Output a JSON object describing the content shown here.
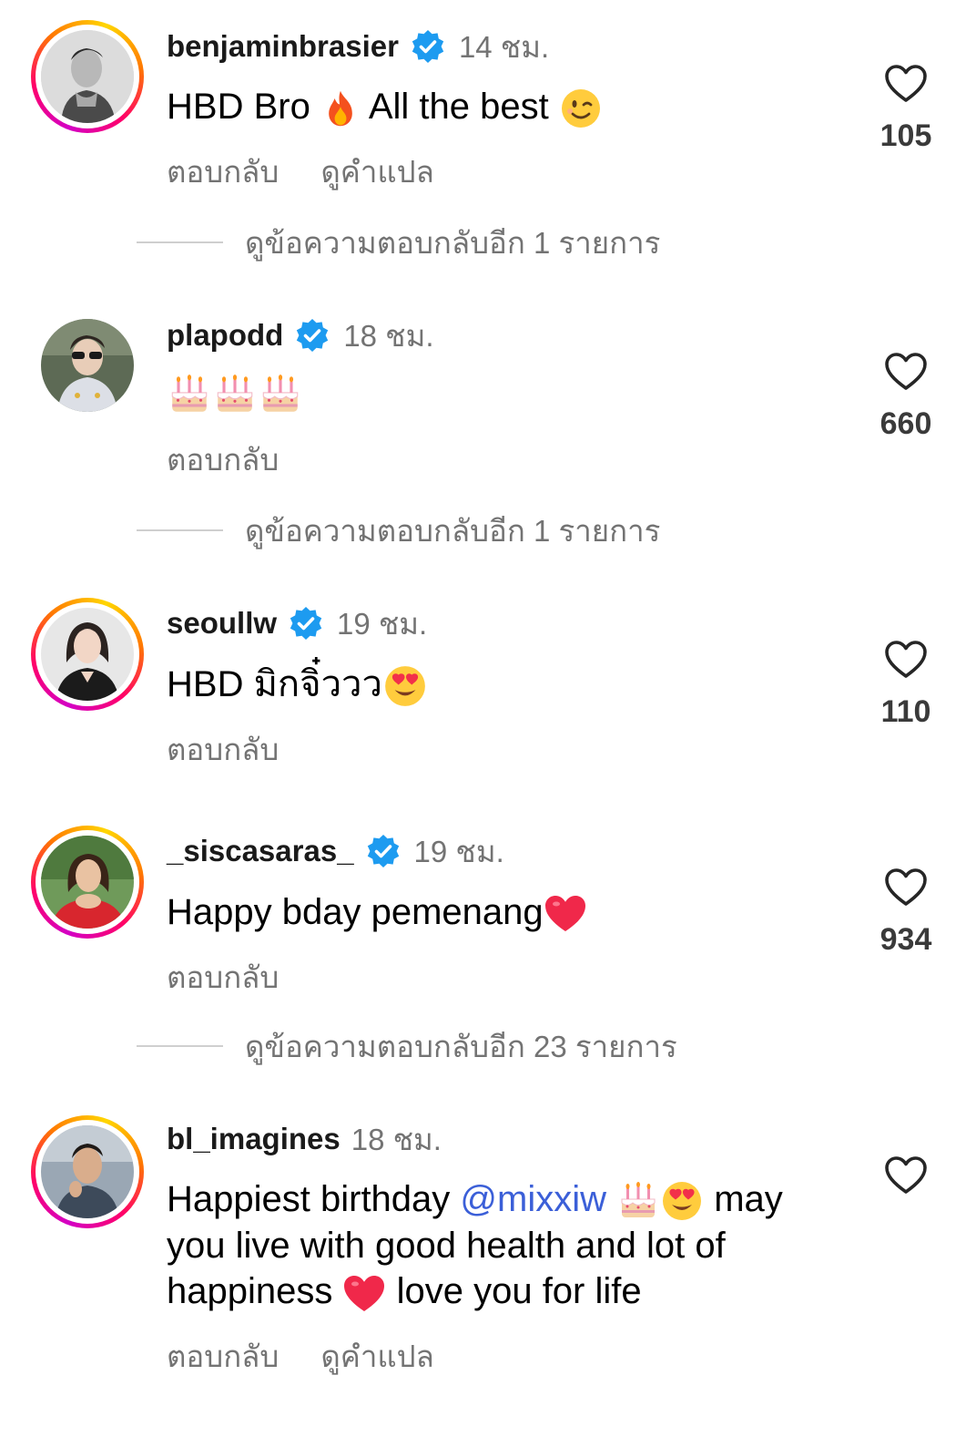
{
  "comments": [
    {
      "username": "benjaminbrasier",
      "verified": true,
      "time": "14 ชม.",
      "text_parts": [
        "HBD Bro ",
        " All the best "
      ],
      "emojis": [
        "fire",
        "wink"
      ],
      "actions": [
        "ตอบกลับ",
        "ดูคำแปล"
      ],
      "likes": "105",
      "ring": true,
      "view_replies": "ดูข้อความตอบกลับอีก 1 รายการ"
    },
    {
      "username": "plapodd",
      "verified": true,
      "time": "18 ชม.",
      "emojis": [
        "cake",
        "cake",
        "cake"
      ],
      "actions": [
        "ตอบกลับ"
      ],
      "likes": "660",
      "ring": false,
      "view_replies": "ดูข้อความตอบกลับอีก 1 รายการ"
    },
    {
      "username": "seoullw",
      "verified": true,
      "time": "19 ชม.",
      "text_parts": [
        "HBD มิกจิ๋ววว"
      ],
      "emojis": [
        "heart-eyes"
      ],
      "actions": [
        "ตอบกลับ"
      ],
      "likes": "110",
      "ring": true
    },
    {
      "username": "_siscasaras_",
      "verified": true,
      "time": "19 ชม.",
      "text_parts": [
        "Happy bday pemenang"
      ],
      "emojis": [
        "red-heart"
      ],
      "actions": [
        "ตอบกลับ"
      ],
      "likes": "934",
      "ring": true,
      "view_replies": "ดูข้อความตอบกลับอีก 23 รายการ"
    },
    {
      "username": "bl_imagines",
      "verified": false,
      "time": "18 ชม.",
      "text_line1_a": "Happiest birthday ",
      "mention": "@mixxiw",
      "text_line1_b": " may",
      "text_line2": "you live with good health and lot of",
      "text_line3_a": "happiness ",
      "text_line3_b": " love you for life",
      "emojis": [
        "cake",
        "heart-eyes",
        "red-heart"
      ],
      "actions": [
        "ตอบกลับ",
        "ดูคำแปล"
      ],
      "ring": true
    }
  ],
  "icons": {
    "like": "heart-outline-icon",
    "verified": "verified-badge-icon"
  },
  "colors": {
    "verified": "#1d9bf0",
    "secondary_text": "#737373",
    "mention": "#3b5fd8"
  }
}
